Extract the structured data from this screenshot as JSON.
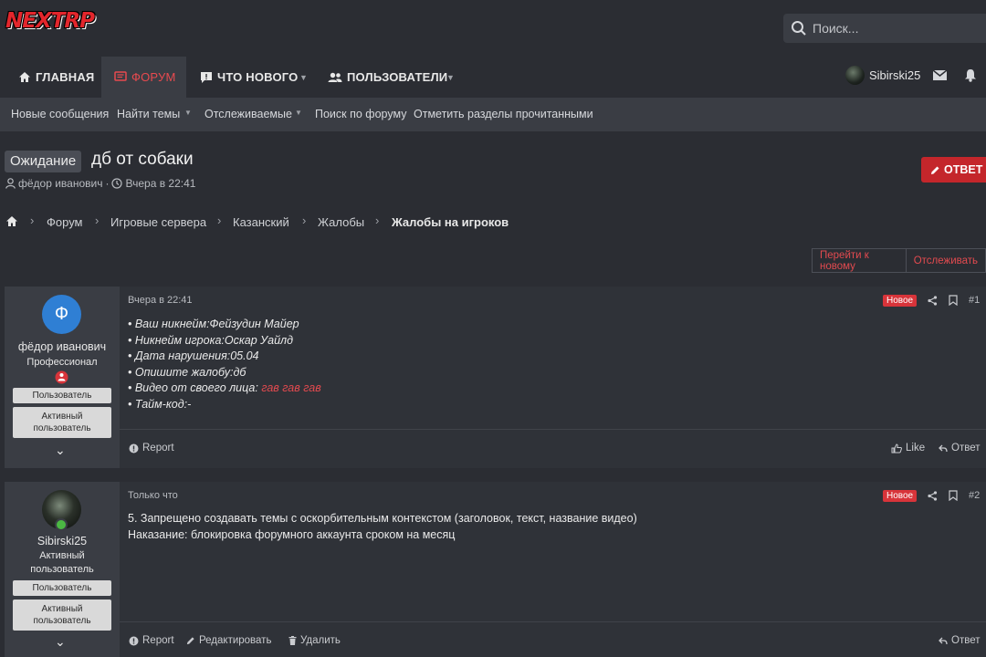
{
  "header": {
    "logo_text": "NEXTRP",
    "search_placeholder": "Поиск..."
  },
  "nav": {
    "items": [
      {
        "label": "ГЛАВНАЯ",
        "icon": "home-icon"
      },
      {
        "label": "ФОРУМ",
        "icon": "forum-icon",
        "active": true
      },
      {
        "label": "ЧТО НОВОГО",
        "icon": "whats-new-icon"
      },
      {
        "label": "ПОЛЬЗОВАТЕЛИ",
        "icon": "users-icon"
      }
    ],
    "username": "Sibirski25"
  },
  "subnav": {
    "items": [
      "Новые сообщения",
      "Найти темы",
      "Отслеживаемые",
      "Поиск по форуму",
      "Отметить разделы прочитанными"
    ]
  },
  "thread": {
    "prefix": "Ожидание",
    "title": "дб от собаки",
    "author": "фёдор иванович",
    "date": "Вчера в 22:41",
    "reply_label": "ОТВЕТ"
  },
  "breadcrumb": [
    "Форум",
    "Игровые сервера",
    "Казанский",
    "Жалобы",
    "Жалобы на игроков"
  ],
  "actions": {
    "go_new": "Перейти к новому",
    "watch": "Отслеживать"
  },
  "posts": [
    {
      "author": "фёдор иванович",
      "avatar_letter": "Ф",
      "user_title": "Профессионал",
      "badges": [
        "Пользователь",
        "Активный пользователь"
      ],
      "date": "Вчера в 22:41",
      "new_label": "Новое",
      "number": "#1",
      "lines": [
        "• Ваш никнейм:Фейзудин Майер",
        "• Никнейм игрока:Оскар Уайлд",
        "• Дата нарушения:05.04",
        "• Опишите жалобу:дб",
        "• Видео от своего лица: ",
        "• Тайм-код:-"
      ],
      "video_link": "гав гав гав",
      "footer": {
        "report": "Report",
        "like": "Like",
        "reply": "Ответ"
      }
    },
    {
      "author": "Sibirski25",
      "user_title_1": "Активный",
      "user_title_2": "пользователь",
      "badges": [
        "Пользователь",
        "Активный пользователь"
      ],
      "date": "Только что",
      "new_label": "Новое",
      "number": "#2",
      "lines": [
        "5. Запрещено создавать темы с оскорбительным контекстом (заголовок, текст, название видео)",
        "Наказание: блокировка форумного аккаунта сроком на месяц"
      ],
      "footer": {
        "report": "Report",
        "edit": "Редактировать",
        "delete": "Удалить",
        "reply": "Ответ"
      }
    }
  ],
  "colors": {
    "accent": "#c4262b",
    "link_red": "#e24a4f",
    "bg": "#2b2d33",
    "panel": "#3a3d44"
  }
}
